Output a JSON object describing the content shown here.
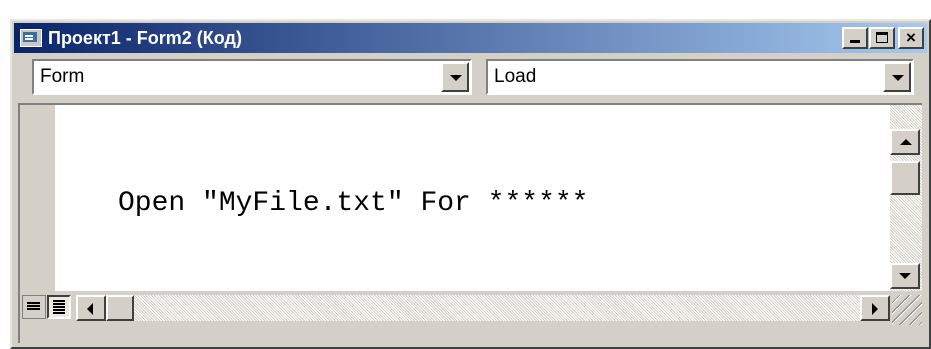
{
  "page_fragment": "",
  "window": {
    "title": "Проект1 - Form2 (Код)",
    "buttons": {
      "minimize": "minimize",
      "maximize": "maximize",
      "close": "×"
    }
  },
  "toolbar": {
    "object_combo": {
      "value": "Form"
    },
    "procedure_combo": {
      "value": "Load"
    }
  },
  "editor": {
    "lines": [
      "Open \"MyFile.txt\" For ******"
    ],
    "view_buttons": [
      "procedure-view",
      "full-module-view"
    ]
  },
  "colors": {
    "titlebar_start": "#0a246a",
    "titlebar_end": "#a6caf0",
    "face": "#d4d0c8"
  }
}
